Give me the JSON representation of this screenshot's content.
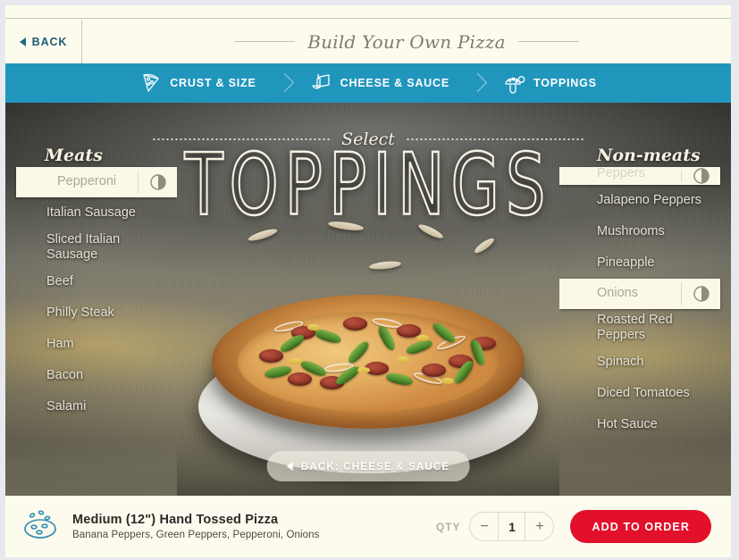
{
  "header": {
    "back_label": "BACK",
    "title": "Build Your Own Pizza"
  },
  "steps": [
    {
      "label": "CRUST & SIZE",
      "icon": "pizza-slice-icon"
    },
    {
      "label": "CHEESE & SAUCE",
      "icon": "cheese-sauce-icon"
    },
    {
      "label": "TOPPINGS",
      "icon": "mushroom-icon"
    }
  ],
  "stage": {
    "eyebrow": "Select",
    "headline": "TOPPINGS",
    "back_step_label": "BACK: CHEESE & SAUCE"
  },
  "left_column": {
    "title": "Meats",
    "items": [
      {
        "label": "Pepperoni",
        "selected": true,
        "portion": "half-portion-icon"
      },
      {
        "label": "Italian Sausage",
        "selected": false
      },
      {
        "label": "Sliced Italian Sausage",
        "selected": false
      },
      {
        "label": "Beef",
        "selected": false
      },
      {
        "label": "Philly Steak",
        "selected": false
      },
      {
        "label": "Ham",
        "selected": false
      },
      {
        "label": "Bacon",
        "selected": false
      },
      {
        "label": "Salami",
        "selected": false
      }
    ]
  },
  "right_column": {
    "title": "Non-meats",
    "items": [
      {
        "label": "Peppers",
        "selected": true,
        "clipped": true,
        "portion": "half-portion-icon"
      },
      {
        "label": "Jalapeno Peppers",
        "selected": false
      },
      {
        "label": "Mushrooms",
        "selected": false
      },
      {
        "label": "Pineapple",
        "selected": false
      },
      {
        "label": "Onions",
        "selected": true,
        "portion": "half-portion-icon"
      },
      {
        "label": "Roasted Red Peppers",
        "selected": false
      },
      {
        "label": "Spinach",
        "selected": false
      },
      {
        "label": "Diced Tomatoes",
        "selected": false
      },
      {
        "label": "Hot Sauce",
        "selected": false
      }
    ]
  },
  "footer": {
    "pizza_icon": "pizza-line-icon",
    "product_title": "Medium (12\") Hand Tossed Pizza",
    "product_toppings": "Banana Peppers, Green Peppers, Pepperoni, Onions",
    "qty_label": "QTY",
    "qty_value": "1",
    "decrement_label": "−",
    "increment_label": "+",
    "add_to_order_label": "ADD TO ORDER"
  },
  "colors": {
    "teal": "#2196bd",
    "cream": "#fdfbee",
    "red": "#e2102a",
    "ink": "#2b2b27"
  }
}
